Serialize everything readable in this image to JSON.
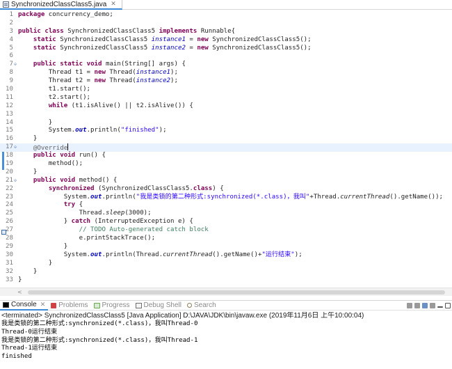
{
  "editor_tab": {
    "title": "SynchronizedClassClass5.java",
    "close": "✕"
  },
  "code_lines": [
    {
      "num": "1",
      "fold": "",
      "segs": [
        [
          "k",
          "package"
        ],
        [
          "t",
          " concurrency_demo;"
        ]
      ]
    },
    {
      "num": "2",
      "fold": "",
      "segs": []
    },
    {
      "num": "3",
      "fold": "",
      "segs": [
        [
          "k",
          "public"
        ],
        [
          "t",
          " "
        ],
        [
          "k",
          "class"
        ],
        [
          "t",
          " SynchronizedClassClass5 "
        ],
        [
          "k",
          "implements"
        ],
        [
          "t",
          " Runnable{"
        ]
      ]
    },
    {
      "num": "4",
      "fold": "",
      "segs": [
        [
          "t",
          "    "
        ],
        [
          "k",
          "static"
        ],
        [
          "t",
          " SynchronizedClassClass5 "
        ],
        [
          "f",
          "instance1"
        ],
        [
          "t",
          " = "
        ],
        [
          "k",
          "new"
        ],
        [
          "t",
          " SynchronizedClassClass5();"
        ]
      ]
    },
    {
      "num": "5",
      "fold": "",
      "segs": [
        [
          "t",
          "    "
        ],
        [
          "k",
          "static"
        ],
        [
          "t",
          " SynchronizedClassClass5 "
        ],
        [
          "f",
          "instance2"
        ],
        [
          "t",
          " = "
        ],
        [
          "k",
          "new"
        ],
        [
          "t",
          " SynchronizedClassClass5();"
        ]
      ]
    },
    {
      "num": "6",
      "fold": "",
      "segs": []
    },
    {
      "num": "7",
      "fold": "⊖",
      "segs": [
        [
          "t",
          "    "
        ],
        [
          "k",
          "public"
        ],
        [
          "t",
          " "
        ],
        [
          "k",
          "static"
        ],
        [
          "t",
          " "
        ],
        [
          "k",
          "void"
        ],
        [
          "t",
          " main(String[] args) {"
        ]
      ]
    },
    {
      "num": "8",
      "fold": "",
      "segs": [
        [
          "t",
          "        Thread t1 = "
        ],
        [
          "k",
          "new"
        ],
        [
          "t",
          " Thread("
        ],
        [
          "f",
          "instance1"
        ],
        [
          "t",
          ");"
        ]
      ]
    },
    {
      "num": "9",
      "fold": "",
      "segs": [
        [
          "t",
          "        Thread t2 = "
        ],
        [
          "k",
          "new"
        ],
        [
          "t",
          " Thread("
        ],
        [
          "f",
          "instance2"
        ],
        [
          "t",
          ");"
        ]
      ]
    },
    {
      "num": "10",
      "fold": "",
      "segs": [
        [
          "t",
          "        t1.start();"
        ]
      ]
    },
    {
      "num": "11",
      "fold": "",
      "segs": [
        [
          "t",
          "        t2.start();"
        ]
      ]
    },
    {
      "num": "12",
      "fold": "",
      "segs": [
        [
          "t",
          "        "
        ],
        [
          "k",
          "while"
        ],
        [
          "t",
          " (t1.isAlive() || t2.isAlive()) {"
        ]
      ]
    },
    {
      "num": "13",
      "fold": "",
      "segs": []
    },
    {
      "num": "14",
      "fold": "",
      "segs": [
        [
          "t",
          "        }"
        ]
      ]
    },
    {
      "num": "15",
      "fold": "",
      "segs": [
        [
          "t",
          "        System."
        ],
        [
          "sf",
          "out"
        ],
        [
          "t",
          ".println("
        ],
        [
          "s",
          "\"finished\""
        ],
        [
          "t",
          ");"
        ]
      ]
    },
    {
      "num": "16",
      "fold": "",
      "segs": [
        [
          "t",
          "    }"
        ]
      ]
    },
    {
      "num": "17",
      "fold": "⊖",
      "current": true,
      "segs": [
        [
          "t",
          "    "
        ],
        [
          "a",
          "@Override"
        ]
      ]
    },
    {
      "num": "18",
      "fold": "",
      "segs": [
        [
          "t",
          "    "
        ],
        [
          "k",
          "public"
        ],
        [
          "t",
          " "
        ],
        [
          "k",
          "void"
        ],
        [
          "t",
          " run() {"
        ]
      ]
    },
    {
      "num": "19",
      "fold": "",
      "segs": [
        [
          "t",
          "        method();"
        ]
      ]
    },
    {
      "num": "20",
      "fold": "",
      "segs": [
        [
          "t",
          "    }"
        ]
      ]
    },
    {
      "num": "21",
      "fold": "⊖",
      "segs": [
        [
          "t",
          "    "
        ],
        [
          "k",
          "public"
        ],
        [
          "t",
          " "
        ],
        [
          "k",
          "void"
        ],
        [
          "t",
          " method() {"
        ]
      ]
    },
    {
      "num": "22",
      "fold": "",
      "segs": [
        [
          "t",
          "        "
        ],
        [
          "k",
          "synchronized"
        ],
        [
          "t",
          " (SynchronizedClassClass5."
        ],
        [
          "k",
          "class"
        ],
        [
          "t",
          ") {"
        ]
      ]
    },
    {
      "num": "23",
      "fold": "",
      "segs": [
        [
          "t",
          "            System."
        ],
        [
          "sf",
          "out"
        ],
        [
          "t",
          ".println("
        ],
        [
          "s",
          "\"我是类锁的第二种形式:synchronized(*.class)，我叫\""
        ],
        [
          "t",
          "+Thread."
        ],
        [
          "i",
          "currentThread"
        ],
        [
          "t",
          "().getName());"
        ]
      ]
    },
    {
      "num": "24",
      "fold": "",
      "segs": [
        [
          "t",
          "            "
        ],
        [
          "k",
          "try"
        ],
        [
          "t",
          " {"
        ]
      ]
    },
    {
      "num": "25",
      "fold": "",
      "segs": [
        [
          "t",
          "                Thread."
        ],
        [
          "i",
          "sleep"
        ],
        [
          "t",
          "(3000);"
        ]
      ]
    },
    {
      "num": "26",
      "fold": "",
      "segs": [
        [
          "t",
          "            } "
        ],
        [
          "k",
          "catch"
        ],
        [
          "t",
          " (InterruptedException e) {"
        ]
      ]
    },
    {
      "num": "27",
      "fold": "",
      "segs": [
        [
          "t",
          "                "
        ],
        [
          "c",
          "// TODO Auto-generated catch block"
        ]
      ]
    },
    {
      "num": "28",
      "fold": "",
      "segs": [
        [
          "t",
          "                e.printStackTrace();"
        ]
      ]
    },
    {
      "num": "29",
      "fold": "",
      "segs": [
        [
          "t",
          "            }"
        ]
      ]
    },
    {
      "num": "30",
      "fold": "",
      "segs": [
        [
          "t",
          "            System."
        ],
        [
          "sf",
          "out"
        ],
        [
          "t",
          ".println(Thread."
        ],
        [
          "i",
          "currentThread"
        ],
        [
          "t",
          "().getName()+"
        ],
        [
          "s",
          "\"运行结束\""
        ],
        [
          "t",
          ");"
        ]
      ]
    },
    {
      "num": "31",
      "fold": "",
      "segs": [
        [
          "t",
          "        }"
        ]
      ]
    },
    {
      "num": "32",
      "fold": "",
      "segs": [
        [
          "t",
          "    }"
        ]
      ]
    },
    {
      "num": "33",
      "fold": "",
      "segs": [
        [
          "t",
          "}"
        ]
      ]
    }
  ],
  "console_tabs": [
    {
      "label": "Console",
      "icon": "console-icon",
      "active": true,
      "close": "✕"
    },
    {
      "label": "Problems",
      "icon": "problems-icon",
      "active": false
    },
    {
      "label": "Progress",
      "icon": "progress-icon",
      "active": false
    },
    {
      "label": "Debug Shell",
      "icon": "debugshell-icon",
      "active": false
    },
    {
      "label": "Search",
      "icon": "search-icon",
      "active": false
    }
  ],
  "console": {
    "header": "<terminated> SynchronizedClassClass5 [Java Application] D:\\JAVA\\JDK\\bin\\javaw.exe (2019年11月6日 上午10:00:04)",
    "output": [
      "我是类锁的第二种形式:synchronized(*.class)，我叫Thread-0",
      "Thread-0运行结束",
      "我是类锁的第二种形式:synchronized(*.class)，我叫Thread-1",
      "Thread-1运行结束",
      "finished"
    ]
  },
  "colors": {
    "keyword": "#7f0055",
    "field": "#0000c0",
    "string": "#2a00ff",
    "comment": "#3f7f5f",
    "tab_accent": "#3b8ad9"
  }
}
